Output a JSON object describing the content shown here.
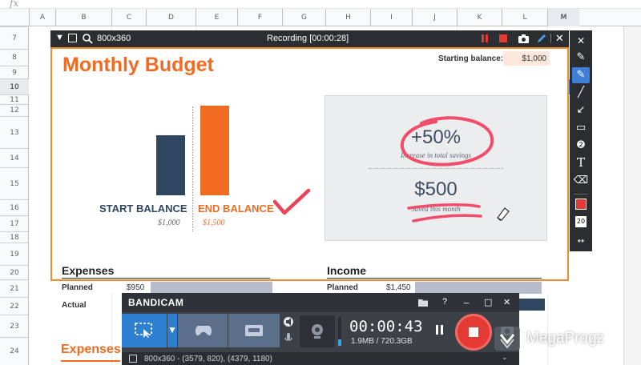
{
  "spreadsheet": {
    "fx_label": "fx",
    "columns": [
      "A",
      "B",
      "C",
      "D",
      "E",
      "F",
      "G",
      "H",
      "I",
      "J",
      "K",
      "L",
      "M"
    ],
    "rows": [
      "7",
      "8",
      "9",
      "10",
      "11",
      "12",
      "13",
      "14",
      "15",
      "16",
      "17",
      "18",
      "19",
      "20",
      "21",
      "22",
      "23",
      "24"
    ]
  },
  "recording": {
    "size_label": "800x360",
    "status": "Recording [00:00:28]"
  },
  "budget": {
    "title": "Monthly Budget",
    "starting_balance_label": "Starting balance:",
    "starting_balance_value": "$1,000",
    "start_label": "START BALANCE",
    "start_value": "$1,000",
    "end_label": "END BALANCE",
    "end_value": "$1,500",
    "savings_pct": "+50%",
    "savings_pct_caption": "Increase in total savings",
    "saved_amount": "$500",
    "saved_caption": "Saved this month",
    "expenses_header": "Expenses",
    "income_header": "Income",
    "planned_label": "Planned",
    "actual_label": "Actual",
    "expenses_planned": "$950",
    "income_planned": "$1,450",
    "lower_expenses_header": "Expenses"
  },
  "chart_data": {
    "type": "bar",
    "categories": [
      "START BALANCE",
      "END BALANCE"
    ],
    "values": [
      1000,
      1500
    ],
    "colors": [
      "#2f4660",
      "#f26b22"
    ]
  },
  "bandicam": {
    "title": "BANDICAM",
    "timer": "00:00:43",
    "file_size": "1.9MB / 720.3GB",
    "region_info": "800x360 - (3579, 820), (4379, 1180)",
    "help": "?",
    "minimize": "_",
    "restore": "□",
    "close": "✕"
  },
  "watermark": {
    "text": "MegaProgz"
  },
  "colors": {
    "accent_orange": "#f26b22",
    "navy": "#2f4660",
    "record_red": "#e53935",
    "bandicam_blue": "#2f7fd0"
  }
}
